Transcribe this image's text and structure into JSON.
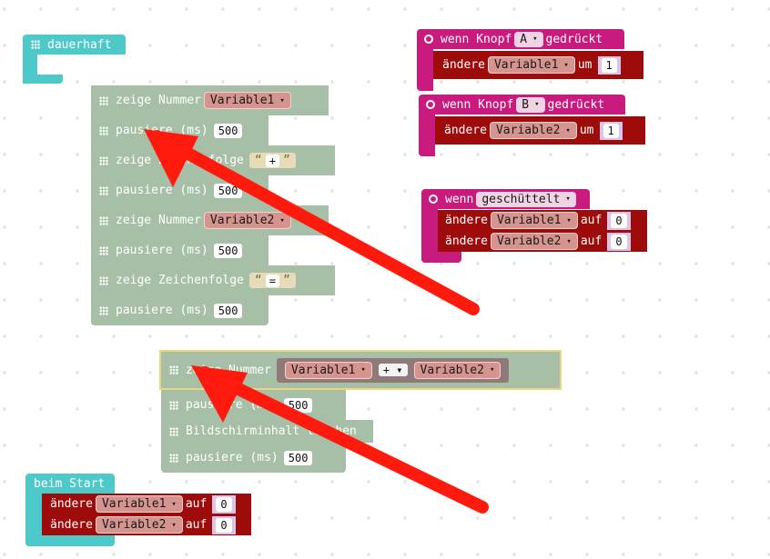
{
  "colors": {
    "event": "#4ec9c9",
    "basic": "#a7bfa6",
    "input": "#c91b7d",
    "variable": "#9e0b0b",
    "annotation": "#ff1a0d"
  },
  "forever": {
    "label": "dauerhaft"
  },
  "forever_blocks": [
    {
      "label": "zeige Nummer",
      "arg_type": "var",
      "arg": "Variable1"
    },
    {
      "label": "pausiere (ms)",
      "arg_type": "num",
      "arg": "500"
    },
    {
      "label": "zeige Zeichenfolge",
      "arg_type": "str",
      "arg": "+"
    },
    {
      "label": "pausiere (ms)",
      "arg_type": "num",
      "arg": "500"
    },
    {
      "label": "zeige Nummer",
      "arg_type": "var",
      "arg": "Variable2"
    },
    {
      "label": "pausiere (ms)",
      "arg_type": "num",
      "arg": "500"
    },
    {
      "label": "zeige Zeichenfolge",
      "arg_type": "str",
      "arg": "="
    },
    {
      "label": "pausiere (ms)",
      "arg_type": "num",
      "arg": "500"
    }
  ],
  "sum_blocks": [
    {
      "label": "zeige Nummer",
      "left": "Variable1",
      "op": "+",
      "right": "Variable2"
    },
    {
      "label": "pausiere (ms)",
      "arg": "500"
    },
    {
      "label": "Bildschirminhalt löschen"
    },
    {
      "label": "pausiere (ms)",
      "arg": "500"
    }
  ],
  "button_a": {
    "prefix": "wenn Knopf",
    "button": "A",
    "suffix": "gedrückt",
    "action": "ändere",
    "variable": "Variable1",
    "by": "um",
    "value": "1"
  },
  "button_b": {
    "prefix": "wenn Knopf",
    "button": "B",
    "suffix": "gedrückt",
    "action": "ändere",
    "variable": "Variable2",
    "by": "um",
    "value": "1"
  },
  "shake": {
    "prefix": "wenn",
    "gesture": "geschüttelt",
    "rows": [
      {
        "action": "ändere",
        "variable": "Variable1",
        "to": "auf",
        "value": "0"
      },
      {
        "action": "ändere",
        "variable": "Variable2",
        "to": "auf",
        "value": "0"
      }
    ]
  },
  "start": {
    "label": "beim Start",
    "rows": [
      {
        "action": "ändere",
        "variable": "Variable1",
        "to": "auf",
        "value": "0"
      },
      {
        "action": "ändere",
        "variable": "Variable2",
        "to": "auf",
        "value": "0"
      }
    ]
  },
  "dropdown_arrow": "▾"
}
